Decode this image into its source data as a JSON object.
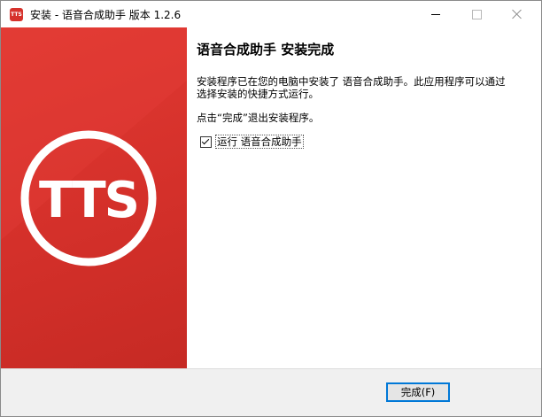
{
  "window": {
    "title": "安装 - 语音合成助手 版本 1.2.6",
    "app_icon_text": "TTS"
  },
  "banner": {
    "logo_text": "TTS",
    "colors": {
      "background": "#d6322c",
      "ring": "#ffffff"
    }
  },
  "content": {
    "heading": "语音合成助手 安装完成",
    "paragraph1": "安装程序已在您的电脑中安装了 语音合成助手。此应用程序可以通过选择安装的快捷方式运行。",
    "paragraph2": "点击“完成”退出安装程序。",
    "run_checkbox": {
      "label": "运行 语音合成助手",
      "checked": true
    }
  },
  "footer": {
    "finish_label": "完成(F)"
  },
  "colors": {
    "accent": "#0078d7",
    "footer_bg": "#f0f0f0"
  }
}
